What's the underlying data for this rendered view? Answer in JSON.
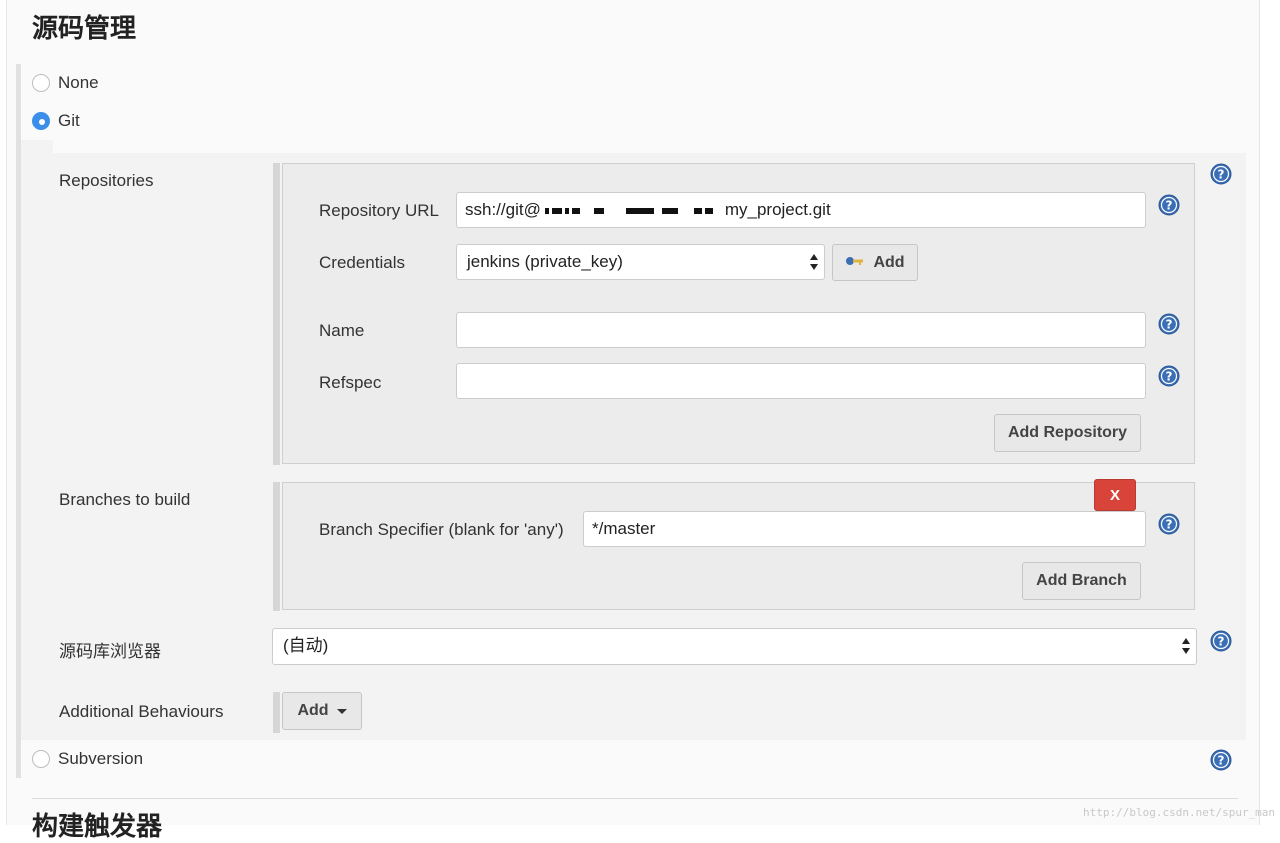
{
  "section": {
    "title": "源码管理",
    "next_title": "构建触发器"
  },
  "scm_options": {
    "none": "None",
    "git": "Git",
    "subversion": "Subversion",
    "selected": "Git"
  },
  "repositories": {
    "label": "Repositories",
    "url_label": "Repository URL",
    "url_prefix": "ssh://git@",
    "url_suffix": "my_project.git",
    "credentials_label": "Credentials",
    "credentials_value": "jenkins (private_key)",
    "add_credentials_label": "Add",
    "name_label": "Name",
    "name_value": "",
    "refspec_label": "Refspec",
    "refspec_value": "",
    "add_repository_label": "Add Repository"
  },
  "branches": {
    "label": "Branches to build",
    "delete_label": "X",
    "specifier_label": "Branch Specifier (blank for 'any')",
    "specifier_value": "*/master",
    "add_branch_label": "Add Branch"
  },
  "browser": {
    "label": "源码库浏览器",
    "value": "(自动)"
  },
  "behaviours": {
    "label": "Additional Behaviours",
    "add_label": "Add"
  },
  "watermark": "http://blog.csdn.net/spur_man",
  "colors": {
    "accent": "#3b8eea",
    "help": "#3a6eb5",
    "danger": "#d9443a"
  },
  "icons": {
    "help": "question-circle",
    "credentials": "key",
    "dropdown": "caret-down"
  }
}
